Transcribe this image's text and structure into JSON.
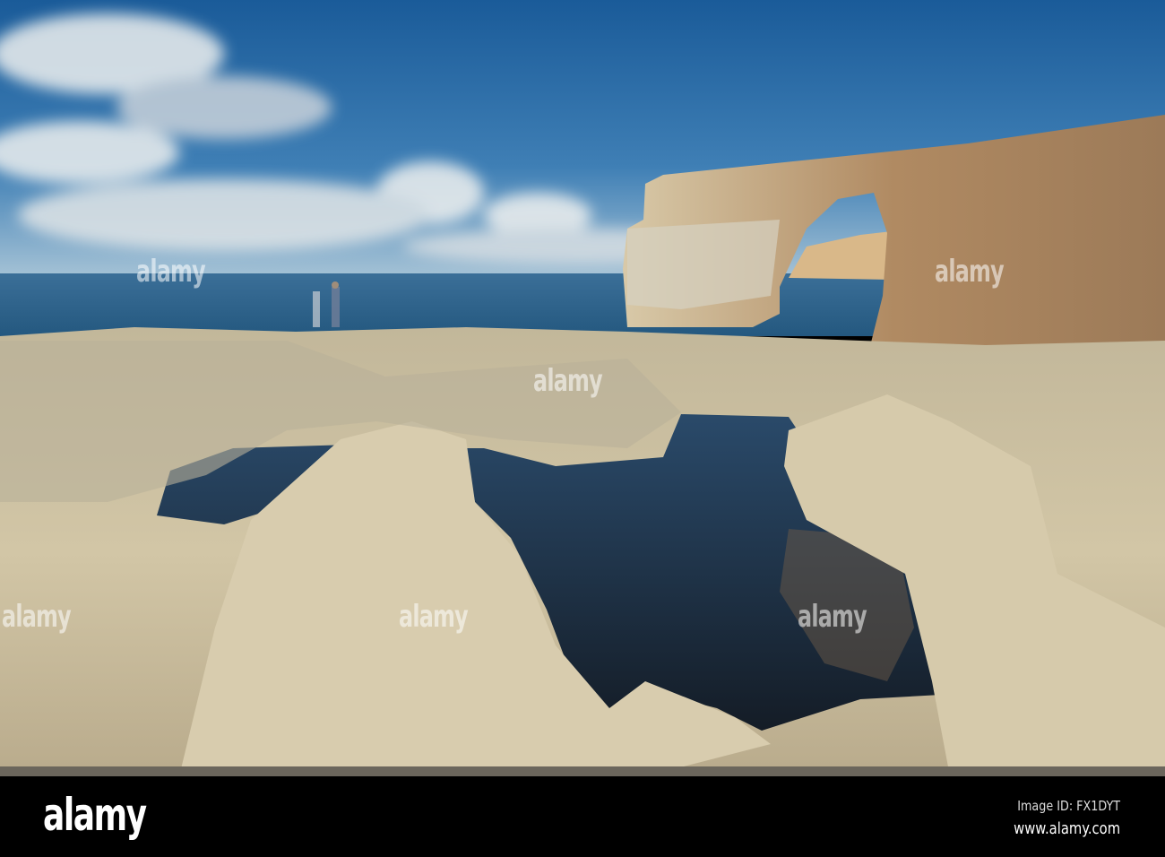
{
  "photo": {
    "subject": "Azure Window rock arch and tidal pool",
    "colors": {
      "sky_top": "#1d5e9c",
      "sky_horizon": "#9cbfd6",
      "sea": "#2e5f88",
      "rock": "#cbbc98",
      "pool": "#1b2636"
    }
  },
  "watermark": {
    "text": "alamy"
  },
  "footer": {
    "logo": "alamy",
    "image_id": "Image ID: FX1DYT",
    "website": "www.alamy.com"
  }
}
